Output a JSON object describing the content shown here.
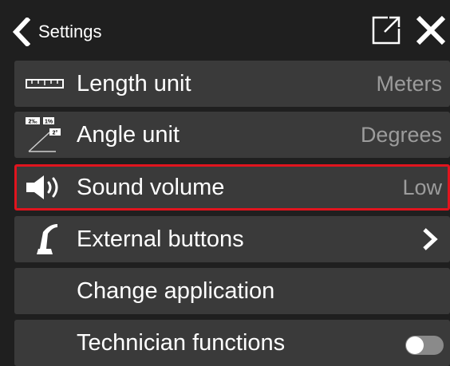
{
  "header": {
    "title": "Settings"
  },
  "rows": [
    {
      "icon": "ruler-icon",
      "label": "Length unit",
      "value": "Meters"
    },
    {
      "icon": "angle-icon",
      "label": "Angle unit",
      "value": "Degrees",
      "icon_texts": [
        "2‰",
        "1%",
        "2°"
      ]
    },
    {
      "icon": "speaker-icon",
      "label": "Sound volume",
      "value": "Low",
      "selected": true
    },
    {
      "icon": "joystick-icon",
      "label": "External buttons",
      "trailing": "chevron-right-icon"
    },
    {
      "label": "Change application"
    },
    {
      "label": "Technician functions",
      "toggle": {
        "state": "off"
      }
    }
  ],
  "colors": {
    "background": "#1f1f1f",
    "row": "#3a3a3a",
    "selection_border": "#e0141e",
    "value_text": "#9c9c9c"
  }
}
